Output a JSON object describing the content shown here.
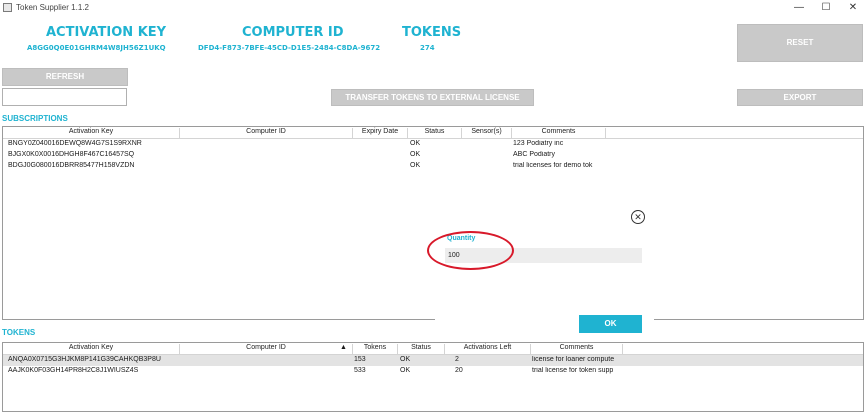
{
  "window": {
    "title": "Token Supplier 1.1.2",
    "min": "—",
    "max": "☐",
    "close": "✕"
  },
  "header": {
    "activation_key_label": "ACTIVATION KEY",
    "activation_key_value": "A8GG0Q0E01GHRM4W8JH56Z1UKQ",
    "computer_id_label": "COMPUTER ID",
    "computer_id_value": "DFD4-F873-7BFE-45CD-D1E5-2484-C8DA-9672",
    "tokens_label": "TOKENS",
    "tokens_value": "274"
  },
  "buttons": {
    "reset": "RESET",
    "refresh": "REFRESH",
    "transfer": "TRANSFER TOKENS TO EXTERNAL LICENSE",
    "export": "EXPORT"
  },
  "subscriptions": {
    "label": "SUBSCRIPTIONS",
    "columns": [
      "Activation Key",
      "Computer ID",
      "Expiry Date",
      "Status",
      "Sensor(s)",
      "Comments"
    ],
    "rows": [
      {
        "key": "BNGY0Z040016DEWQ8W4G7S1S9RXNR",
        "computer_id": "",
        "expiry": "",
        "status": "OK",
        "sensors": "",
        "comments": "123 Podiatry inc"
      },
      {
        "key": "BJGX0K0X0016DHGH8F467C16457SQ",
        "computer_id": "",
        "expiry": "",
        "status": "OK",
        "sensors": "",
        "comments": "ABC Podiatry"
      },
      {
        "key": "BDGJ0G080016DBRR85477H158VZDN",
        "computer_id": "",
        "expiry": "",
        "status": "OK",
        "sensors": "",
        "comments": "trial licenses for demo tok"
      }
    ]
  },
  "tokens": {
    "label": "TOKENS",
    "columns": [
      "Activation Key",
      "Computer ID",
      "Tokens",
      "Status",
      "Activations Left",
      "Comments"
    ],
    "sort_indicator": "▲",
    "rows": [
      {
        "key": "ANQA0X0715G3HJKM8P141G39CAHKQB3P8U",
        "computer_id": "",
        "tokens": "153",
        "status": "OK",
        "activations_left": "2",
        "comments": "license for loaner compute"
      },
      {
        "key": "AAJK0K0F03GH14PR8H2C8J1WIUSZ4S",
        "computer_id": "",
        "tokens": "533",
        "status": "OK",
        "activations_left": "20",
        "comments": "trial license for token supp"
      }
    ]
  },
  "dialog": {
    "close_glyph": "✕",
    "quantity_label": "Quantity",
    "quantity_value": "100",
    "ok": "OK"
  }
}
